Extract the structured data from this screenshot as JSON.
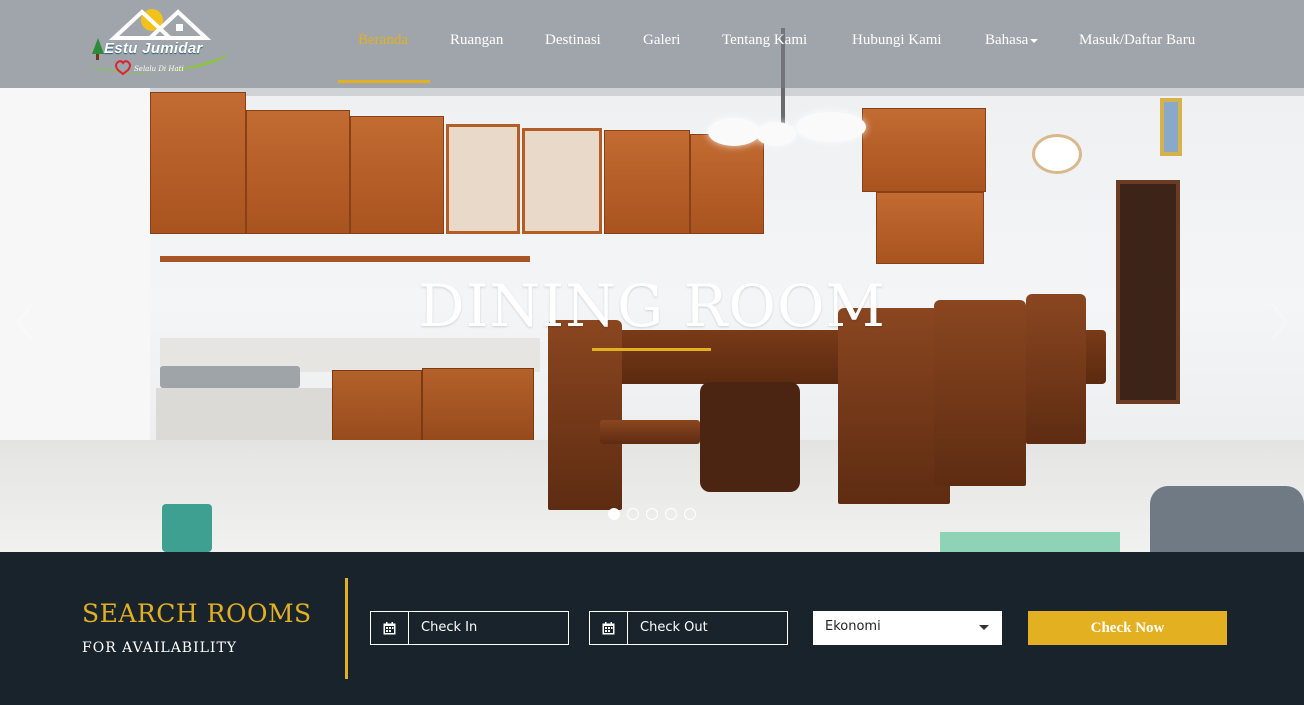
{
  "brand": {
    "name": "Estu Jumidar",
    "tagline": "Selalu Di Hati"
  },
  "nav": {
    "items": [
      {
        "label": "Beranda",
        "active": true
      },
      {
        "label": "Ruangan",
        "active": false
      },
      {
        "label": "Destinasi",
        "active": false
      },
      {
        "label": "Galeri",
        "active": false
      },
      {
        "label": "Tentang Kami",
        "active": false
      },
      {
        "label": "Hubungi Kami",
        "active": false
      },
      {
        "label": "Bahasa",
        "active": false,
        "dropdown": true
      },
      {
        "label": "Masuk/Daftar Baru",
        "active": false
      }
    ]
  },
  "hero": {
    "title": "DINING ROOM",
    "slide_count": 5,
    "active_slide": 1
  },
  "search": {
    "title": "SEARCH ROOMS",
    "subtitle": "FOR AVAILABILITY",
    "check_in_placeholder": "Check In",
    "check_out_placeholder": "Check Out",
    "room_type_selected": "Ekonomi",
    "submit_label": "Check Now",
    "icons": {
      "check_in": "calendar-icon",
      "check_out": "calendar-icon",
      "dropdown": "caret-down-icon"
    }
  },
  "colors": {
    "accent": "#e3b021",
    "bar_bg": "#18232c",
    "header_overlay": "rgba(120,128,134,0.55)"
  }
}
